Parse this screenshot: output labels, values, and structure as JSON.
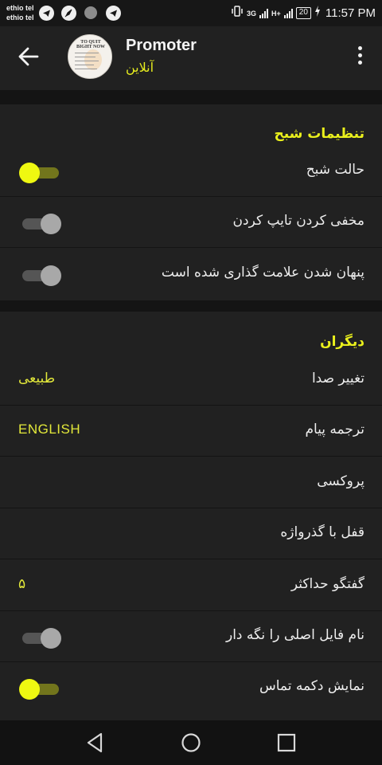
{
  "status_bar": {
    "carrier_1": "ethio tel",
    "carrier_2": "ethio tel",
    "network_1": "3G",
    "network_2": "H+",
    "battery": "20",
    "time": "11:57 PM"
  },
  "toolbar": {
    "title": "Promoter",
    "status": "آنلاین",
    "avatar_text": "TO QUIT BIGHT NOW"
  },
  "sections": {
    "night": {
      "header": "تنظیمات شبح",
      "ghost_mode": {
        "label": "حالت شبح",
        "enabled": true
      },
      "hide_typing": {
        "label": "مخفی کردن تایپ کردن",
        "enabled": false
      },
      "hide_read": {
        "label": "پنهان شدن علامت گذاری شده است",
        "enabled": false
      }
    },
    "other": {
      "header": "دیگران",
      "voice_changer": {
        "label": "تغییر صدا",
        "value": "طبیعی"
      },
      "translate": {
        "label": "ترجمه پیام",
        "value": "ENGLISH"
      },
      "proxy": {
        "label": "پروکسی"
      },
      "passcode": {
        "label": "قفل با گذرواژه"
      },
      "max_chats": {
        "label": "گفتگو حداکثر",
        "value": "۵"
      },
      "keep_filename": {
        "label": "نام فایل اصلی را نگه دار",
        "enabled": false
      },
      "call_button": {
        "label": "نمایش دکمه تماس",
        "enabled": true
      }
    }
  },
  "colors": {
    "accent": "#eaf01c",
    "background": "#212121",
    "divider": "#141414"
  },
  "icons": {
    "back": "arrow-left-icon",
    "menu": "more-vertical-icon",
    "nav_back": "triangle-back-icon",
    "nav_home": "circle-home-icon",
    "nav_recents": "square-recents-icon"
  }
}
